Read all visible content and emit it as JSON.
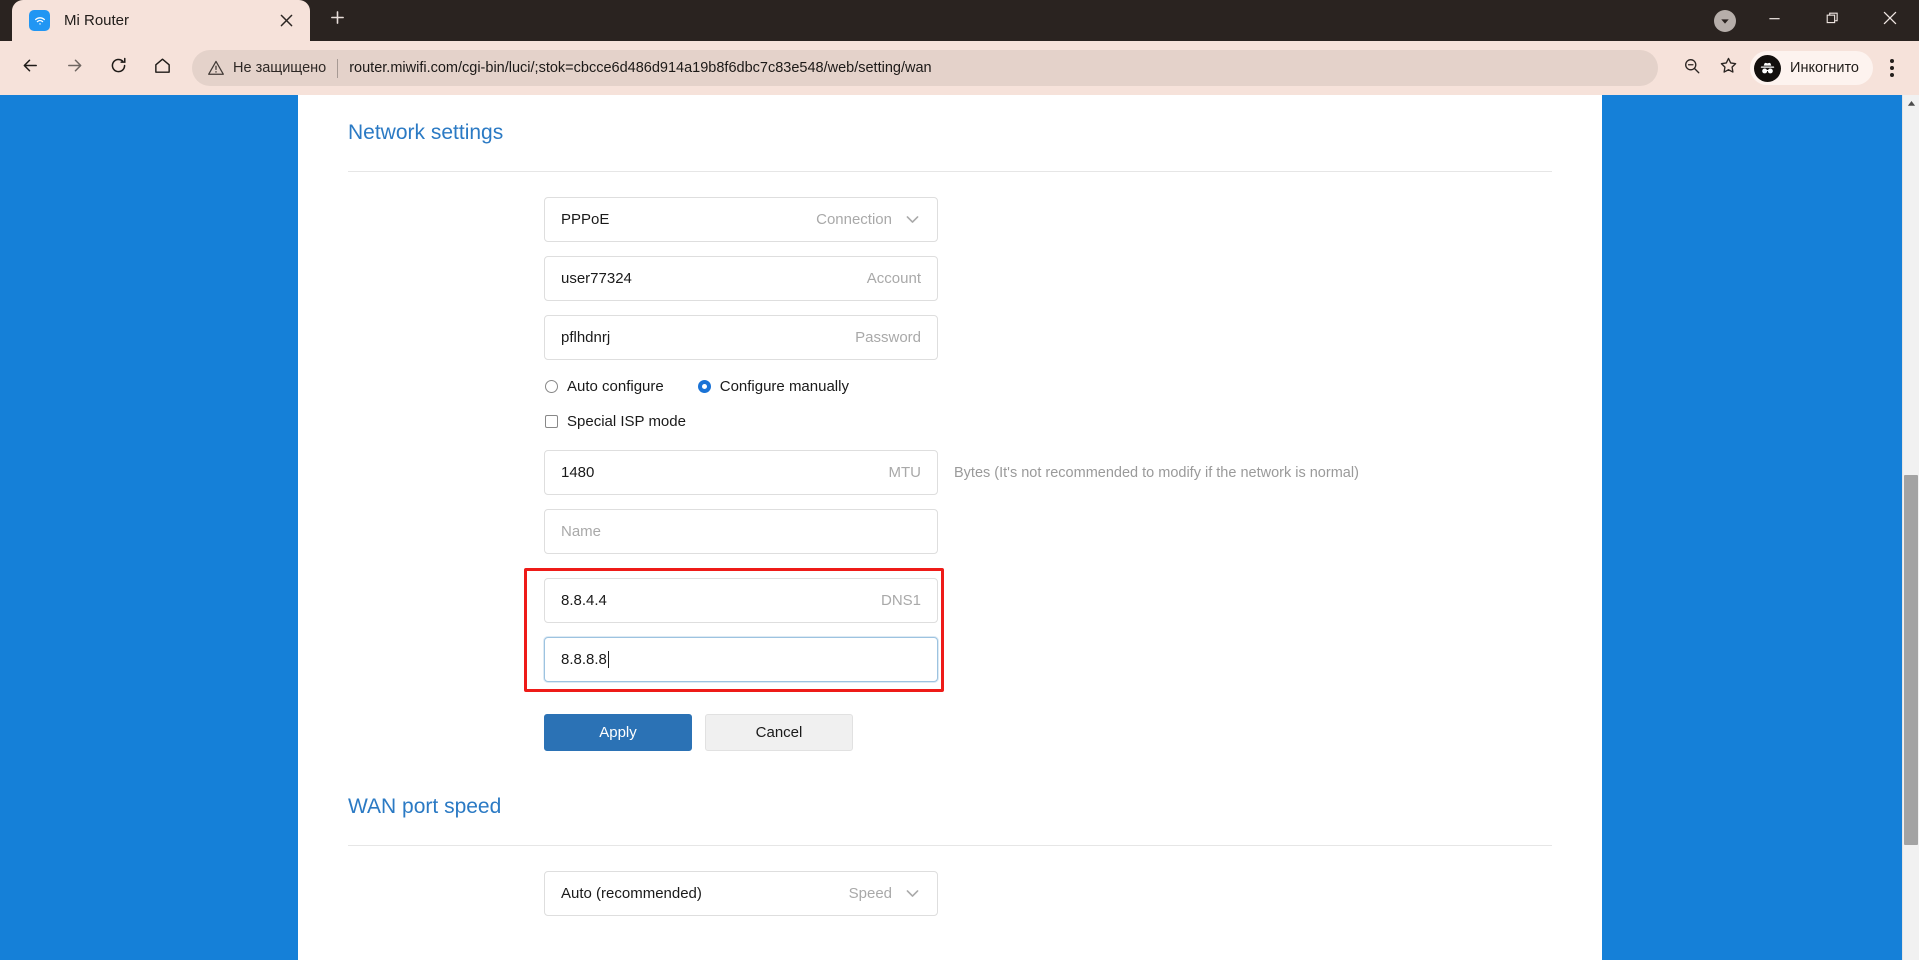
{
  "browser": {
    "tab": {
      "title": "Mi Router",
      "favicon_icon": "wifi-icon",
      "close_icon": "close-icon"
    },
    "new_tab_icon": "plus-icon",
    "window": {
      "tab_search_icon": "chevron-down-circle-icon",
      "minimize_icon": "minimize-icon",
      "restore_icon": "restore-icon",
      "close_icon": "window-close-icon"
    },
    "nav": {
      "back_icon": "arrow-left-icon",
      "forward_icon": "arrow-right-icon",
      "reload_icon": "reload-icon",
      "home_icon": "home-icon"
    },
    "omnibox": {
      "warning_icon": "warning-triangle-icon",
      "security_text": "Не защищено",
      "url": "router.miwifi.com/cgi-bin/luci/;stok=cbcce6d486d914a19b8f6dbc7c83e548/web/setting/wan",
      "zoom_out_icon": "zoom-out-icon",
      "bookmark_icon": "star-icon"
    },
    "profile": {
      "label": "Инкогнито",
      "avatar_icon": "incognito-icon"
    },
    "menu_icon": "three-dots-menu-icon"
  },
  "page": {
    "background_color": "#1580d8",
    "accent_color": "#2b7ac4",
    "highlight_color": "#ee1b18",
    "sections": {
      "network_settings": {
        "title": "Network settings",
        "connection": {
          "value": "PPPoE",
          "label": "Connection",
          "chevron_icon": "chevron-down-icon"
        },
        "account": {
          "value": "user77324",
          "label": "Account",
          "placeholder": "Account"
        },
        "password": {
          "value": "pflhdnrj",
          "label": "Password",
          "placeholder": "Password"
        },
        "config_mode": {
          "options": [
            {
              "label": "Auto configure",
              "selected": false
            },
            {
              "label": "Configure manually",
              "selected": true
            }
          ]
        },
        "special_isp": {
          "label": "Special ISP mode",
          "checked": false
        },
        "mtu": {
          "value": "1480",
          "label": "MTU",
          "hint": "Bytes (It's not recommended to modify if the network is normal)"
        },
        "name": {
          "value": "",
          "label": "",
          "placeholder": "Name"
        },
        "dns1": {
          "value": "8.8.4.4",
          "label": "DNS1"
        },
        "dns2": {
          "value": "8.8.8.8",
          "label": "",
          "focused": true
        },
        "apply_label": "Apply",
        "cancel_label": "Cancel"
      },
      "wan_port_speed": {
        "title": "WAN port speed",
        "speed": {
          "value": "Auto (recommended)",
          "label": "Speed",
          "chevron_icon": "chevron-down-icon"
        }
      }
    },
    "scrollbar": {
      "up_arrow_icon": "scroll-up-arrow-icon"
    }
  }
}
